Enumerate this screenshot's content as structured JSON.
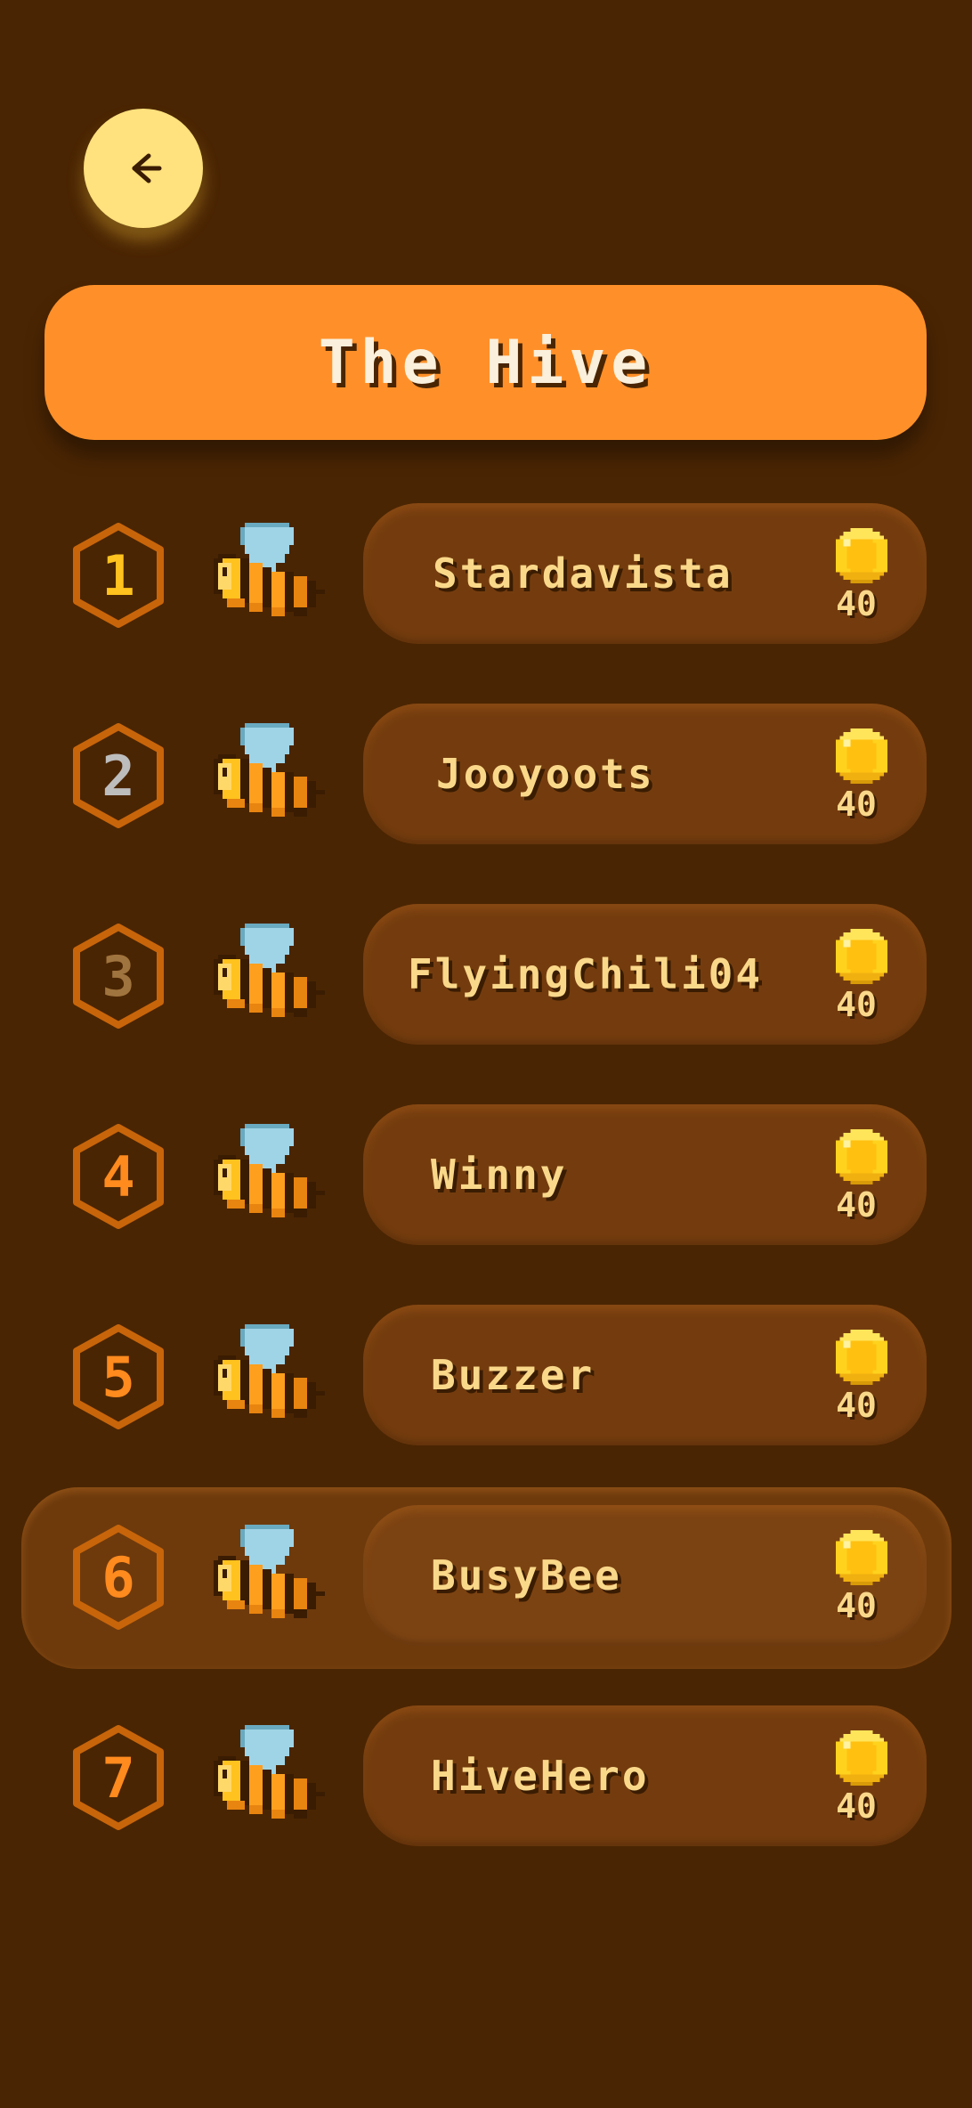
{
  "header": {
    "back_icon": "arrow-left-icon",
    "title": "The Hive"
  },
  "colors": {
    "background": "#4a2503",
    "banner": "#ff9029",
    "back_button": "#ffe17d",
    "card": "#743c0e",
    "highlight_row": "#6e3a0c",
    "name_text": "#fad88a",
    "badge_outline": "#c8650a"
  },
  "leaderboard": {
    "highlighted_rank": 6,
    "entries": [
      {
        "rank": "1",
        "name": "Stardavista",
        "coins": "40",
        "rank_color": "#ffc21e"
      },
      {
        "rank": "2",
        "name": "Jooyoots",
        "coins": "40",
        "rank_color": "#bdbdbd"
      },
      {
        "rank": "3",
        "name": "FlyingChili04",
        "coins": "40",
        "rank_color": "#a0743e"
      },
      {
        "rank": "4",
        "name": "Winny",
        "coins": "40",
        "rank_color": "#ff8a1e"
      },
      {
        "rank": "5",
        "name": "Buzzer",
        "coins": "40",
        "rank_color": "#ff8a1e"
      },
      {
        "rank": "6",
        "name": "BusyBee",
        "coins": "40",
        "rank_color": "#ff8a1e"
      },
      {
        "rank": "7",
        "name": "HiveHero",
        "coins": "40",
        "rank_color": "#ff8a1e"
      }
    ]
  },
  "icons": {
    "avatar": "bee-icon",
    "coin": "coin-icon",
    "rank_badge": "hexagon-badge"
  }
}
